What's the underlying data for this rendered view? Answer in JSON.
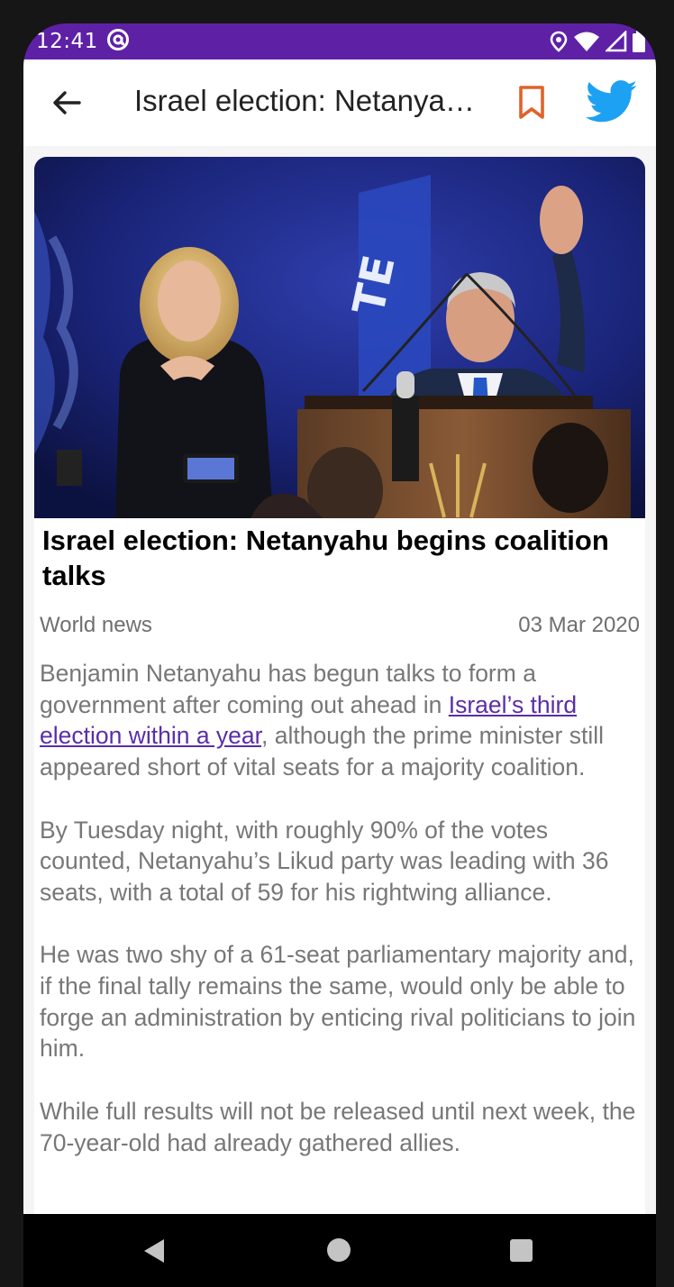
{
  "status_bar": {
    "time": "12:41",
    "icons": [
      "at-sign-icon",
      "location-icon",
      "wifi-icon",
      "signal-icon",
      "battery-icon"
    ]
  },
  "app_bar": {
    "title": "Israel election: Netanyahu begins coalition talks",
    "icons": [
      "back-arrow-icon",
      "bookmark-icon",
      "twitter-icon"
    ]
  },
  "article": {
    "image_alt": "Benjamin Netanyahu waving at podium beside his wife",
    "headline": "Israel election: Netanyahu begins coalition talks",
    "category": "World news",
    "date": "03 Mar 2020",
    "paragraphs": [
      {
        "before": "Benjamin Netanyahu has begun talks to form a government after coming out ahead in ",
        "link": "Israel’s third election within a year",
        "after": ", although the prime minister still appeared short of vital seats for a majority coalition."
      },
      {
        "text": "By Tuesday night, with roughly 90% of the votes counted, Netanyahu’s Likud party was leading with 36 seats, with a total of 59 for his rightwing alliance."
      },
      {
        "text": "He was two shy of a 61-seat parliamentary majority and, if the final tally remains the same, would only be able to forge an administration by enticing rival politicians to join him."
      },
      {
        "text": "While full results will not be released until next week, the 70-year-old had already gathered allies."
      }
    ]
  },
  "colors": {
    "status_bar": "#5e21a6",
    "link": "#5a2ea8",
    "bookmark": "#e0622a",
    "twitter": "#1da1f2"
  },
  "nav_bar": {
    "icons": [
      "back-triangle-icon",
      "home-circle-icon",
      "recents-square-icon"
    ]
  }
}
